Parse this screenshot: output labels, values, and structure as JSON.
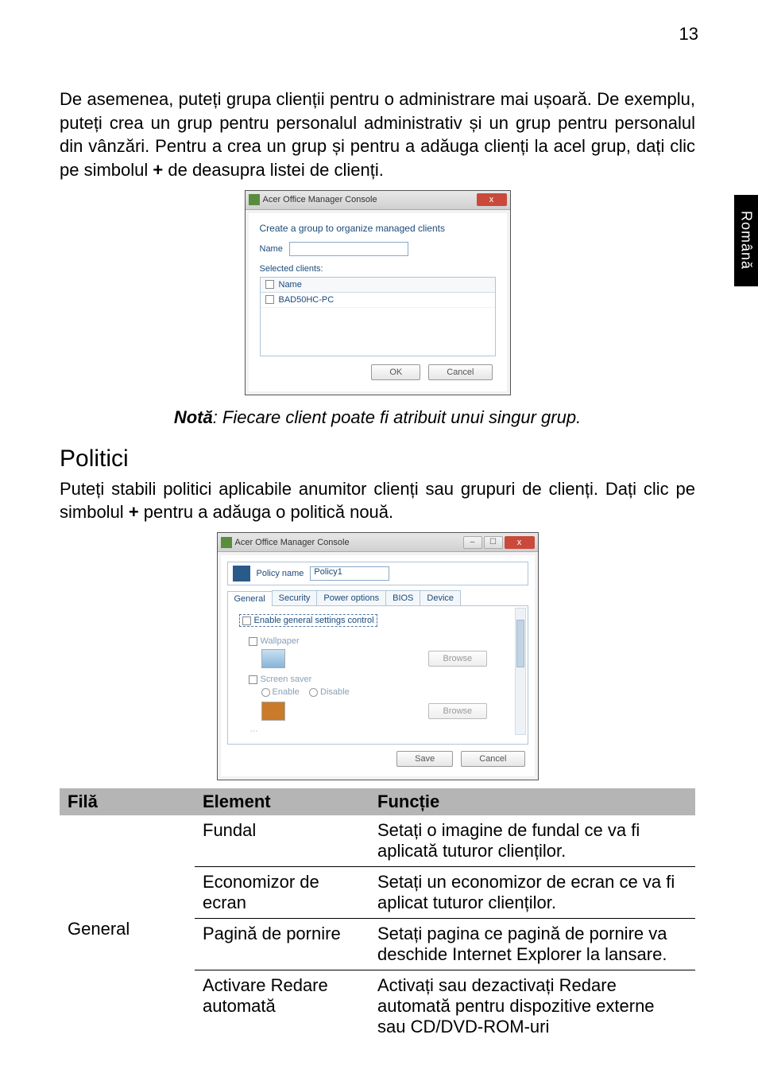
{
  "page_number": "13",
  "side_tab": "Română",
  "para1_pre": "De asemenea, puteți grupa clienții pentru o administrare mai ușoară. De exemplu, puteți crea un grup pentru personalul administrativ și un grup pentru personalul din vânzări. Pentru a crea un grup și pentru a adăuga clienți la acel grup, dați clic pe simbolul ",
  "para1_bold": "+",
  "para1_post": " de deasupra listei de clienți.",
  "dialog1": {
    "title": "Acer Office Manager Console",
    "close": "x",
    "heading": "Create a group to organize managed clients",
    "name_label": "Name",
    "selected_label": "Selected clients:",
    "col_name": "Name",
    "row1": "BAD50HC-PC",
    "ok": "OK",
    "cancel": "Cancel"
  },
  "note_bold": "Notă",
  "note_rest": ": Fiecare client poate fi atribuit unui singur grup.",
  "h2": "Politici",
  "para2_pre": "Puteți stabili politici aplicabile anumitor clienți sau grupuri de clienți. Dați clic pe simbolul ",
  "para2_bold": "+",
  "para2_post": " pentru a adăuga o politică nouă.",
  "dialog2": {
    "title": "Acer Office Manager Console",
    "close": "x",
    "policy_label": "Policy name",
    "policy_value": "Policy1",
    "tabs": [
      "General",
      "Security",
      "Power options",
      "BIOS",
      "Device"
    ],
    "enable_label": "Enable general settings control",
    "wallpaper": "Wallpaper",
    "browse": "Browse",
    "screensaver": "Screen saver",
    "enable_radio": "Enable",
    "disable_radio": "Disable",
    "save": "Save",
    "cancel": "Cancel"
  },
  "table": {
    "h1": "Filă",
    "h2": "Element",
    "h3": "Funcție",
    "cat": "General",
    "rows": [
      {
        "el": "Fundal",
        "fn": "Setați o imagine de fundal ce va fi aplicată tuturor clienților."
      },
      {
        "el": "Economizor de ecran",
        "fn": "Setați un economizor de ecran ce va fi aplicat tuturor clienților."
      },
      {
        "el": "Pagină de pornire",
        "fn": "Setați pagina ce pagină de pornire va deschide Internet Explorer la lansare."
      },
      {
        "el": "Activare Redare automată",
        "fn": "Activați sau dezactivați Redare automată pentru dispozitive externe sau CD/DVD-ROM-uri"
      }
    ]
  }
}
